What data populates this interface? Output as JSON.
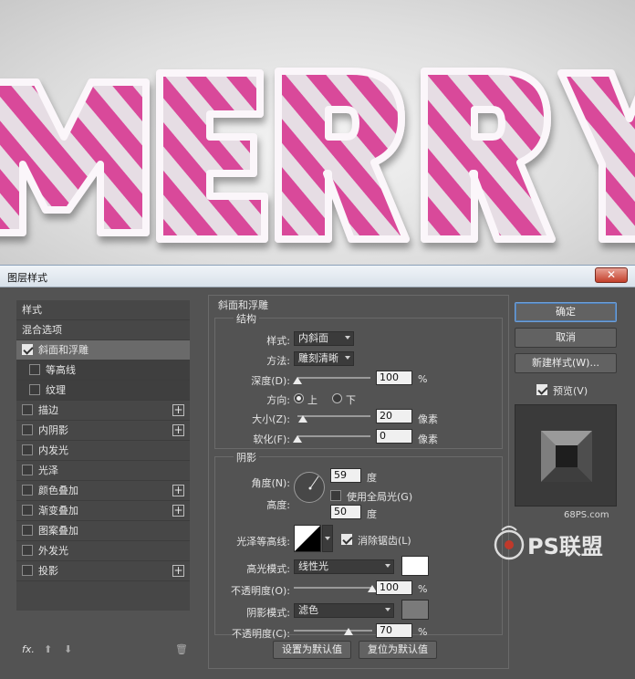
{
  "canvas_text": "MERRY",
  "dialog": {
    "title": "图层样式",
    "close_label": "✕"
  },
  "style_list": {
    "header_styles": "样式",
    "header_blend": "混合选项",
    "items": [
      {
        "label": "斜面和浮雕",
        "checked": true,
        "selected": true,
        "plus": false
      },
      {
        "label": "等高线",
        "checked": false,
        "sub": true
      },
      {
        "label": "纹理",
        "checked": false,
        "sub": true
      },
      {
        "label": "描边",
        "checked": false,
        "plus": true
      },
      {
        "label": "内阴影",
        "checked": false,
        "plus": true
      },
      {
        "label": "内发光",
        "checked": false
      },
      {
        "label": "光泽",
        "checked": false
      },
      {
        "label": "颜色叠加",
        "checked": false,
        "plus": true
      },
      {
        "label": "渐变叠加",
        "checked": false,
        "plus": true
      },
      {
        "label": "图案叠加",
        "checked": false
      },
      {
        "label": "外发光",
        "checked": false
      },
      {
        "label": "投影",
        "checked": false,
        "plus": true
      }
    ],
    "footer_fx": "fx.",
    "footer_up": "⬆",
    "footer_down": "⬇",
    "footer_trash": "🗑"
  },
  "bevel": {
    "group_title": "斜面和浮雕",
    "structure_title": "结构",
    "style_label": "样式:",
    "style_value": "内斜面",
    "method_label": "方法:",
    "method_value": "雕刻清晰",
    "depth_label": "深度(D):",
    "depth_value": "100",
    "depth_unit": "%",
    "depth_level": 0.0,
    "direction_label": "方向:",
    "direction_up": "上",
    "direction_down": "下",
    "size_label": "大小(Z):",
    "size_value": "20",
    "size_unit": "像素",
    "size_level": 0.08,
    "soften_label": "软化(F):",
    "soften_value": "0",
    "soften_unit": "像素",
    "soften_level": 0.0
  },
  "shading": {
    "title": "阴影",
    "angle_label": "角度(N):",
    "angle_value": "59",
    "angle_unit": "度",
    "global_light_label": "使用全局光(G)",
    "global_light_checked": false,
    "altitude_label": "高度:",
    "altitude_value": "50",
    "altitude_unit": "度",
    "gloss_contour_label": "光泽等高线:",
    "anti_alias_label": "消除锯齿(L)",
    "anti_alias_checked": true,
    "highlight_mode_label": "高光模式:",
    "highlight_mode_value": "线性光",
    "highlight_color": "#ffffff",
    "highlight_opacity_label": "不透明度(O):",
    "highlight_opacity_value": "100",
    "highlight_opacity_unit": "%",
    "highlight_opacity_level": 1.0,
    "shadow_mode_label": "阴影模式:",
    "shadow_mode_value": "滤色",
    "shadow_color": "#7a7a7a",
    "shadow_opacity_label": "不透明度(C):",
    "shadow_opacity_value": "70",
    "shadow_opacity_unit": "%",
    "shadow_opacity_level": 0.7
  },
  "footer_buttons": {
    "set_default": "设置为默认值",
    "reset_default": "复位为默认值"
  },
  "right_buttons": {
    "ok": "确定",
    "cancel": "取消",
    "new_style": "新建样式(W)...",
    "preview_label": "预览(V)",
    "preview_checked": true
  },
  "watermark": {
    "site": "68PS.com",
    "brand": "PS联盟"
  },
  "colors": {
    "candy_pink": "#d9499a",
    "candy_light": "#e8dfe6"
  }
}
